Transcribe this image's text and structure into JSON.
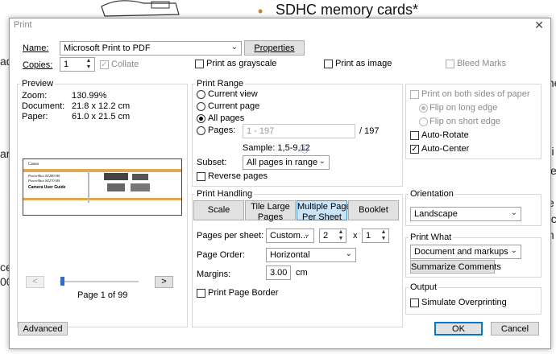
{
  "background": {
    "bullet": "•",
    "heading": "SDHC memory cards*",
    "fragments": [
      "ad",
      "ar",
      "ce",
      "00",
      "me",
      "Fi",
      "ye",
      "e",
      "nc",
      "th"
    ]
  },
  "dialog": {
    "title": "Print",
    "close_glyph": "✕"
  },
  "printer": {
    "name_label": "Name:",
    "name_value": "Microsoft Print to PDF",
    "properties_label": "Properties",
    "copies_label": "Copies:",
    "copies_value": "1",
    "collate_label": "Collate",
    "grayscale_label": "Print as grayscale",
    "as_image_label": "Print as image",
    "bleed_marks_label": "Bleed Marks"
  },
  "preview": {
    "group_label": "Preview",
    "zoom_label": "Zoom:",
    "zoom_value": "130.99%",
    "document_label": "Document:",
    "document_value": "21.8 x 12.2 cm",
    "paper_label": "Paper:",
    "paper_value": "61.0 x 21.5 cm",
    "page_text": "Page 1 of 99",
    "prev_glyph": "<",
    "next_glyph": ">",
    "thumb_brand": "Canon",
    "thumb_line1": "PowerShot SX280 HS",
    "thumb_line2": "PowerShot SX270 HS",
    "thumb_title": "Camera User Guide"
  },
  "print_range": {
    "group_label": "Print Range",
    "current_view": "Current view",
    "current_page": "Current page",
    "all_pages": "All pages",
    "pages": "Pages:",
    "pages_placeholder": "1 - 197",
    "pages_total": "/ 197",
    "sample": "Sample: 1,5-9,12",
    "info_glyph": "ⓘ",
    "subset_label": "Subset:",
    "subset_value": "All pages in range",
    "reverse_label": "Reverse pages"
  },
  "duplex": {
    "both_sides": "Print on both sides of paper",
    "flip_long": "Flip on long edge",
    "flip_short": "Flip on short edge",
    "auto_rotate": "Auto-Rotate",
    "auto_center": "Auto-Center",
    "check_glyph": "✓"
  },
  "handling": {
    "group_label": "Print Handling",
    "scale": "Scale",
    "tile_line1": "Tile Large",
    "tile_line2": "Pages",
    "multi_line1": "Multiple Pages",
    "multi_line2": "Per Sheet",
    "booklet": "Booklet",
    "pages_per_sheet_label": "Pages per sheet:",
    "pages_per_sheet_value": "Custom...",
    "cols_value": "2",
    "x_label": "x",
    "rows_value": "1",
    "page_order_label": "Page Order:",
    "page_order_value": "Horizontal",
    "margins_label": "Margins:",
    "margins_value": "3.00",
    "margins_unit": "cm",
    "border_label": "Print Page Border"
  },
  "orientation": {
    "group_label": "Orientation",
    "value": "Landscape"
  },
  "print_what": {
    "group_label": "Print What",
    "value": "Document and markups",
    "summarize": "Summarize Comments"
  },
  "output": {
    "group_label": "Output",
    "simulate": "Simulate Overprinting"
  },
  "footer": {
    "advanced": "Advanced",
    "ok": "OK",
    "cancel": "Cancel"
  },
  "icons": {
    "dropdown": "chevron-down-icon",
    "spin": "spin-arrows-icon",
    "info": "info-icon",
    "close": "close-icon"
  },
  "colors": {
    "accent": "#0078d7",
    "selected_tab": "#cce4f7",
    "slider_thumb": "#2b6cd4",
    "bullet": "#c8842a"
  }
}
